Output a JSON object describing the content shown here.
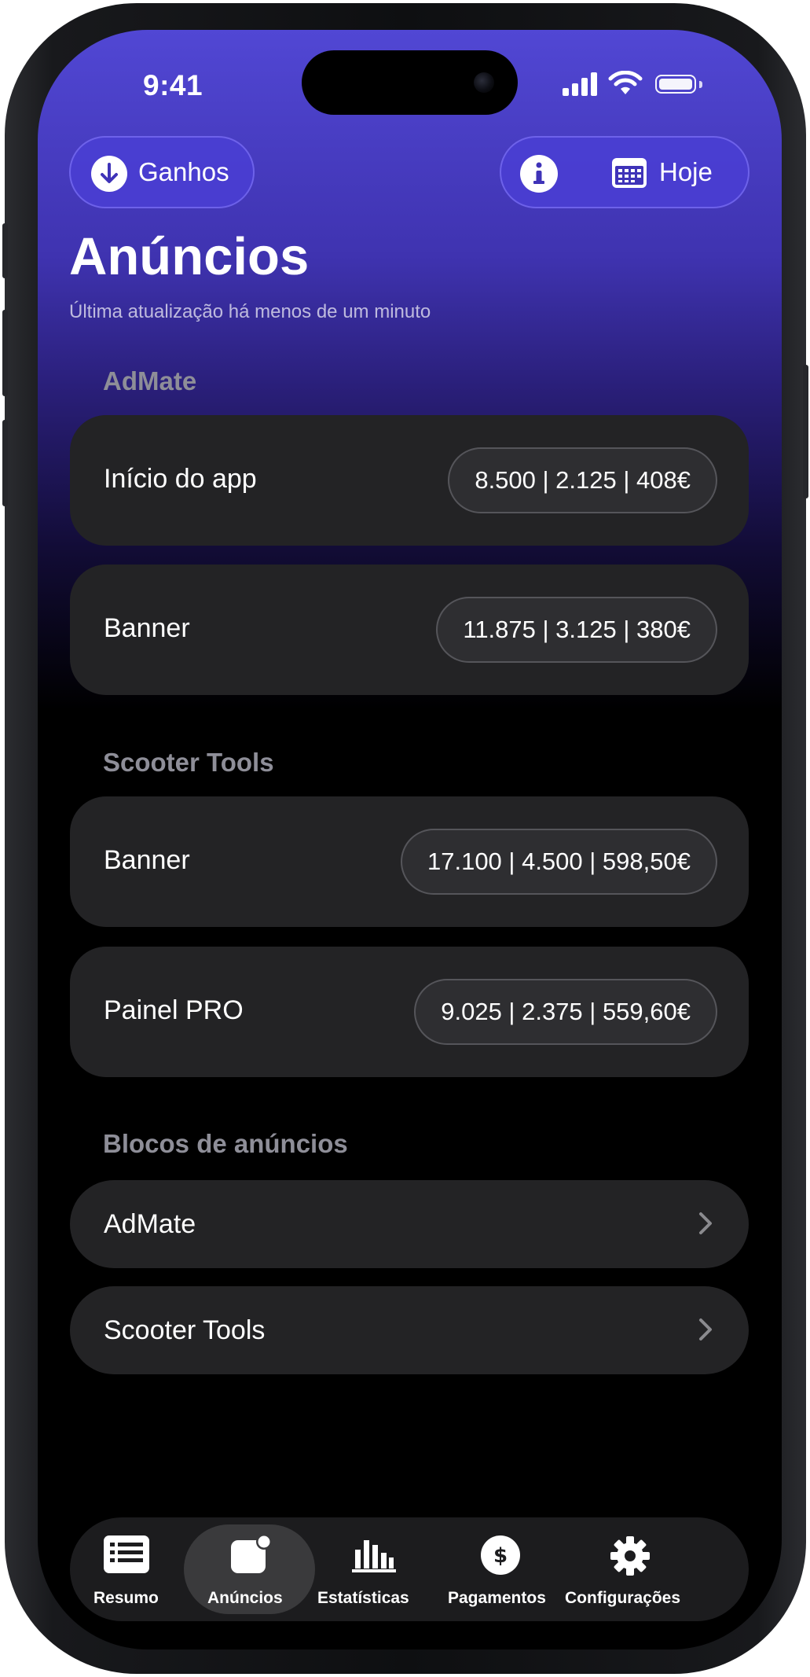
{
  "status_bar": {
    "time": "9:41"
  },
  "header": {
    "earnings_button_label": "Ganhos",
    "date_button_label": "Hoje",
    "title": "Anúncios",
    "subtitle": "Última atualização há menos de um minuto"
  },
  "sections": [
    {
      "title": "AdMate",
      "rows": [
        {
          "label": "Início do app",
          "value": "8.500 | 2.125 | 408€"
        },
        {
          "label": "Banner",
          "value": "11.875 | 3.125 | 380€"
        }
      ]
    },
    {
      "title": "Scooter Tools",
      "rows": [
        {
          "label": "Banner",
          "value": "17.100 | 4.500 | 598,50€"
        },
        {
          "label": "Painel PRO",
          "value": "9.025 | 2.375 | 559,60€"
        }
      ]
    }
  ],
  "ad_blocks": {
    "title": "Blocos de anúncios",
    "items": [
      {
        "label": "AdMate"
      },
      {
        "label": "Scooter Tools"
      }
    ]
  },
  "tabbar": {
    "active": "Anúncios",
    "tabs": [
      {
        "label": "Resumo",
        "icon": "list-icon"
      },
      {
        "label": "Anúncios",
        "icon": "ad-badge-icon"
      },
      {
        "label": "Estatísticas",
        "icon": "bar-chart-icon"
      },
      {
        "label": "Pagamentos",
        "icon": "dollar-circle-icon"
      },
      {
        "label": "Configurações",
        "icon": "gear-icon"
      }
    ]
  },
  "colors": {
    "accent": "#4a3ed4",
    "card_background": "#232325",
    "section_title": "#8e8e98"
  }
}
